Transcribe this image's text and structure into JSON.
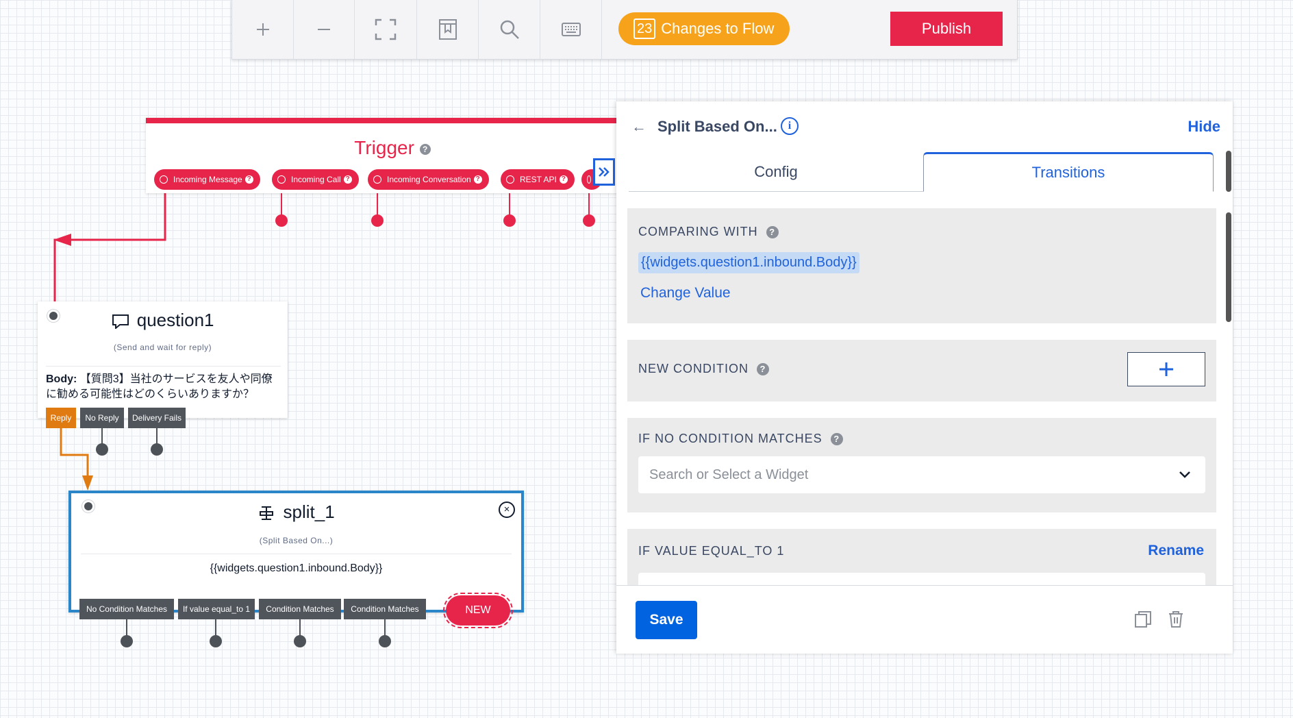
{
  "toolbar": {
    "buttons": [
      {
        "icon": "plus-icon"
      },
      {
        "icon": "minus-icon"
      },
      {
        "icon": "fit-screen-icon"
      },
      {
        "icon": "bookmark-icon"
      },
      {
        "icon": "search-icon"
      },
      {
        "icon": "keyboard-icon"
      }
    ],
    "changes_count": "23",
    "changes_label": "Changes to Flow",
    "publish_label": "Publish",
    "accent_orange": "#f6a31b",
    "accent_red": "#e7254a"
  },
  "trigger": {
    "title": "Trigger",
    "buttons": [
      "Incoming Message",
      "Incoming Call",
      "Incoming Conversation",
      "REST API"
    ]
  },
  "question1": {
    "title": "question1",
    "subtitle": "(Send and wait for reply)",
    "body_label": "Body:",
    "body_text": "【質問3】当社のサービスを友人や同僚に勧める可能性はどのくらいありますか？",
    "transitions": [
      "Reply",
      "No Reply",
      "Delivery Fails"
    ]
  },
  "split": {
    "title": "split_1",
    "subtitle": "(Split Based On...)",
    "value": "{{widgets.question1.inbound.Body}}",
    "transitions": [
      "No Condition Matches",
      "If value equal_to 1",
      "Condition Matches",
      "Condition Matches"
    ],
    "new_label": "NEW"
  },
  "panel": {
    "title": "Split Based On...",
    "hide_label": "Hide",
    "tabs": [
      "Config",
      "Transitions"
    ],
    "active_tab": "Transitions",
    "comparing_label": "COMPARING WITH",
    "comparing_value": "{{widgets.question1.inbound.Body}}",
    "change_value_label": "Change Value",
    "new_condition_label": "NEW CONDITION",
    "no_condition_label": "IF NO CONDITION MATCHES",
    "select_placeholder": "Search or Select a Widget",
    "value_equal_label": "IF VALUE EQUAL_TO 1",
    "rename_label": "Rename",
    "save_label": "Save"
  }
}
